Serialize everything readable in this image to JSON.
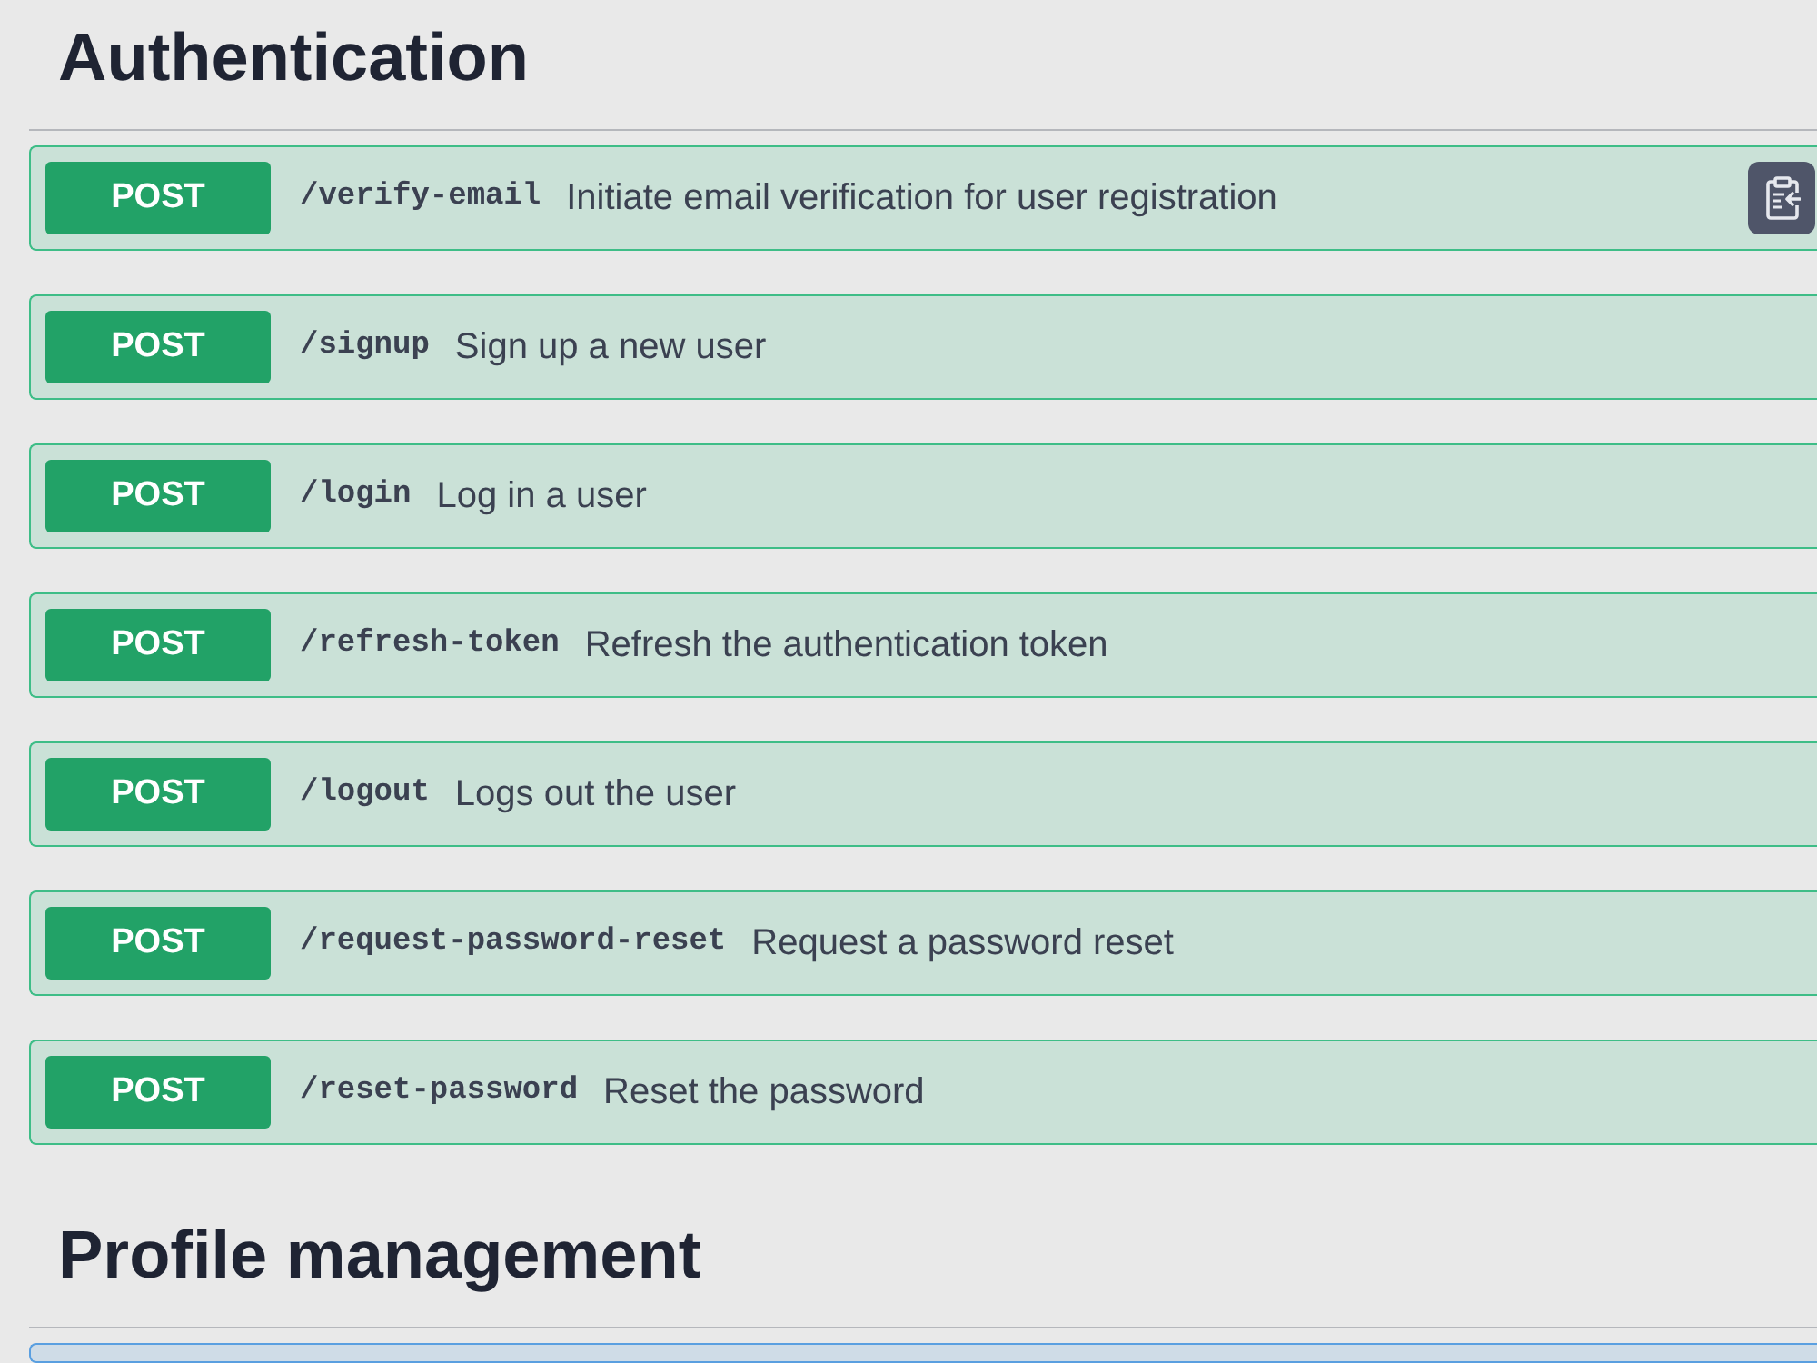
{
  "sections": [
    {
      "title": "Authentication",
      "operations": [
        {
          "method": "POST",
          "path": "/verify-email",
          "summary": "Initiate email verification for user registration",
          "color": "#3ebd87",
          "copy_button": true
        },
        {
          "method": "POST",
          "path": "/signup",
          "summary": "Sign up a new user",
          "color": "#3ebd87",
          "copy_button": false
        },
        {
          "method": "POST",
          "path": "/login",
          "summary": "Log in a user",
          "color": "#3ebd87",
          "copy_button": false
        },
        {
          "method": "POST",
          "path": "/refresh-token",
          "summary": "Refresh the authentication token",
          "color": "#3ebd87",
          "copy_button": false
        },
        {
          "method": "POST",
          "path": "/logout",
          "summary": "Logs out the user",
          "color": "#3ebd87",
          "copy_button": false
        },
        {
          "method": "POST",
          "path": "/request-password-reset",
          "summary": "Request a password reset",
          "color": "#3ebd87",
          "copy_button": false
        },
        {
          "method": "POST",
          "path": "/reset-password",
          "summary": "Reset the password",
          "color": "#3ebd87",
          "copy_button": false
        }
      ]
    },
    {
      "title": "Profile management",
      "operations": [
        {
          "color": "#5a9fe0"
        }
      ]
    }
  ]
}
